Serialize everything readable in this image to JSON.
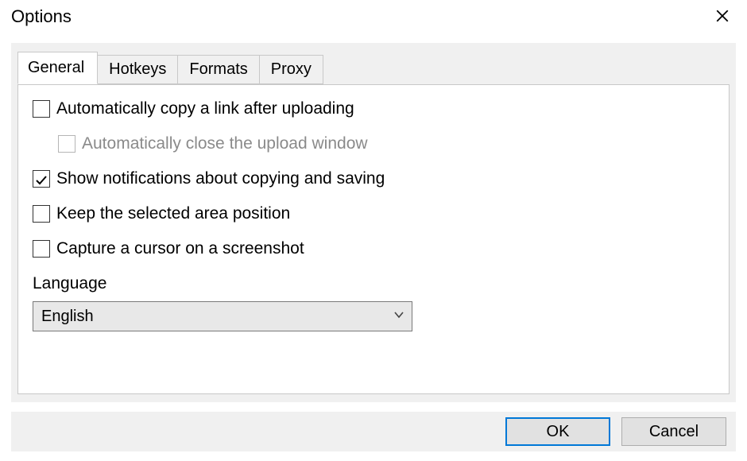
{
  "window": {
    "title": "Options"
  },
  "tabs": {
    "general": "General",
    "hotkeys": "Hotkeys",
    "formats": "Formats",
    "proxy": "Proxy"
  },
  "general": {
    "auto_copy_link": {
      "label": "Automatically copy a link after uploading",
      "checked": false
    },
    "auto_close_upload": {
      "label": "Automatically close the upload window",
      "checked": false,
      "disabled": true
    },
    "show_notifications": {
      "label": "Show notifications about copying and saving",
      "checked": true
    },
    "keep_selected_area": {
      "label": "Keep the selected area position",
      "checked": false
    },
    "capture_cursor": {
      "label": "Capture a cursor on a screenshot",
      "checked": false
    },
    "language_label": "Language",
    "language_value": "English"
  },
  "buttons": {
    "ok": "OK",
    "cancel": "Cancel"
  }
}
